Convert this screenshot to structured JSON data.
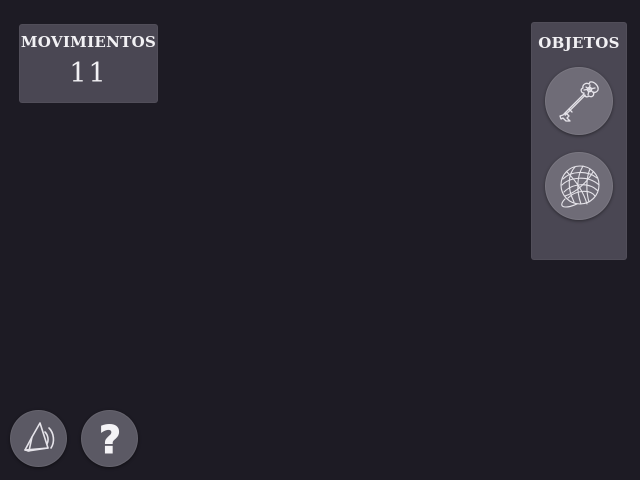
{
  "hud": {
    "moves_label": "MOVIMIENTOS",
    "moves_value": "11"
  },
  "inventory": {
    "title": "OBJETOS",
    "items": [
      {
        "name": "ornate-key",
        "icon": "key-icon"
      },
      {
        "name": "ball-of-yarn",
        "icon": "yarn-ball-icon"
      }
    ]
  },
  "controls": {
    "sound_icon": "speaker-icon",
    "help_icon": "question-mark-icon",
    "help_glyph": "?"
  },
  "colors": {
    "background": "#1d1b24",
    "panel": "#4a4753",
    "slot": "#6f6c77",
    "text": "#f2f1f4"
  }
}
